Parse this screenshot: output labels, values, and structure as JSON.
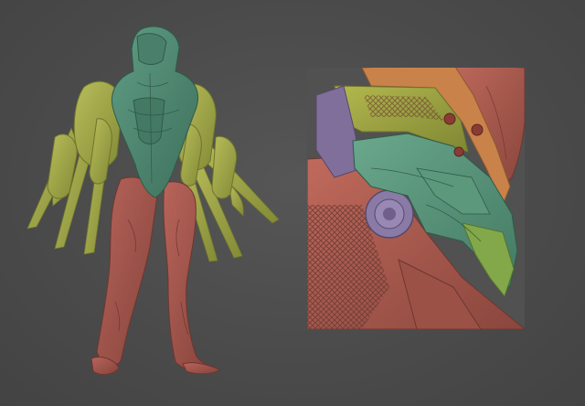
{
  "scene": {
    "colors": {
      "background": "#4a4a4a",
      "teal": "#4f8c74",
      "olive": "#a6ab4a",
      "red": "#a8554a",
      "orange": "#c9824a",
      "purple": "#7f6f9a",
      "green": "#82a84a"
    },
    "full_body_view": {
      "subject": "creature-sculpt",
      "polygroups": [
        "head-torso-teal",
        "shoulders-arms-olive",
        "legs-red"
      ]
    },
    "closeup_view": {
      "subject": "helmet-closeup",
      "polygroups": [
        "crest-red",
        "band-orange",
        "visor-olive",
        "face-teal",
        "ear-purple",
        "neck-red"
      ]
    }
  }
}
